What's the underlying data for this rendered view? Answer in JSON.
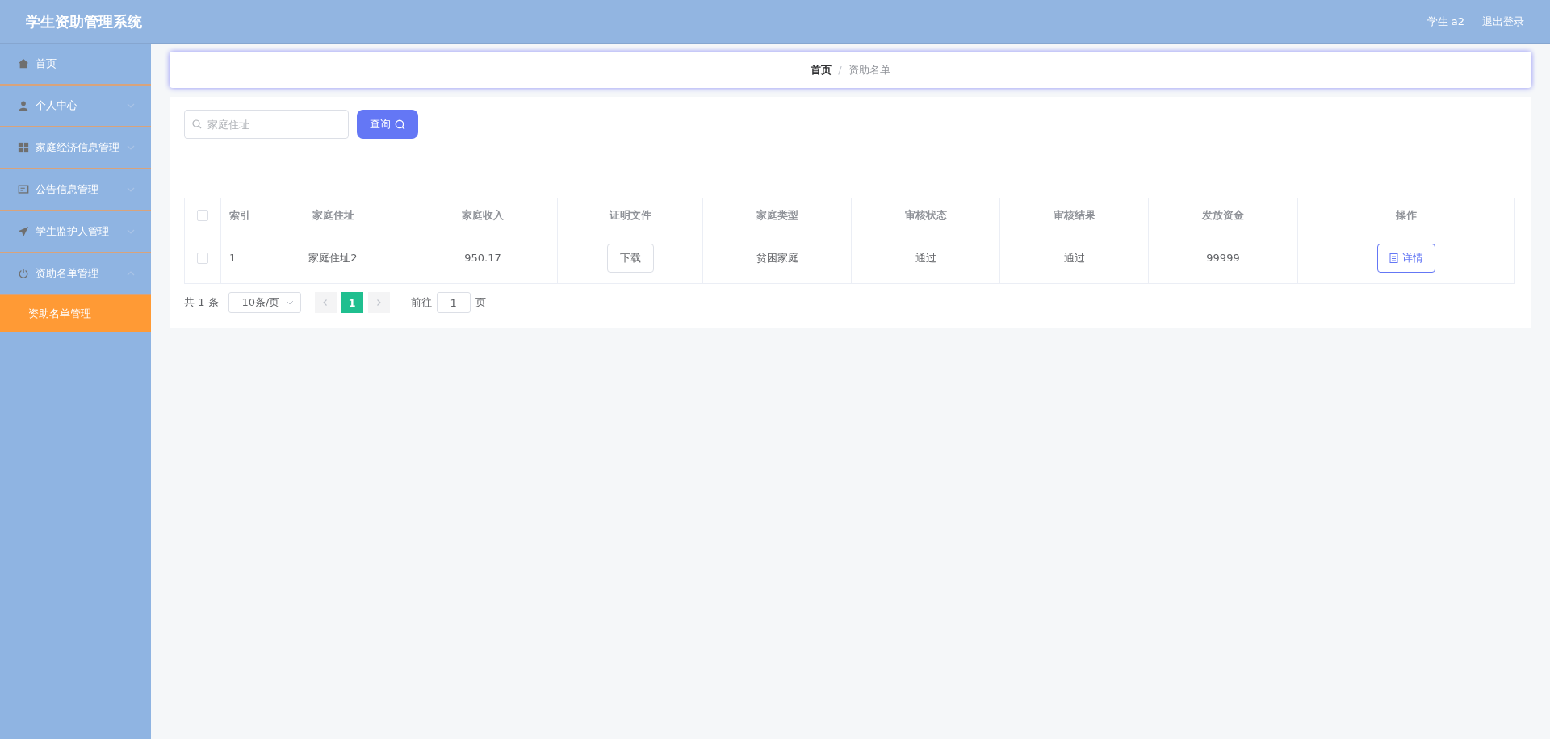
{
  "header": {
    "title": "学生资助管理系统",
    "user": "学生 a2",
    "logout": "退出登录"
  },
  "sidebar": {
    "items": [
      {
        "label": "首页",
        "kind": "home"
      },
      {
        "label": "个人中心",
        "kind": "user",
        "expanded": false
      },
      {
        "label": "家庭经济信息管理",
        "kind": "grid",
        "expanded": false
      },
      {
        "label": "公告信息管理",
        "kind": "monitor",
        "expanded": false
      },
      {
        "label": "学生监护人管理",
        "kind": "send",
        "expanded": false
      },
      {
        "label": "资助名单管理",
        "kind": "power",
        "expanded": true,
        "children": [
          {
            "label": "资助名单管理",
            "selected": true
          }
        ]
      }
    ]
  },
  "breadcrumb": {
    "items": [
      "首页",
      "资助名单"
    ],
    "separator": "/"
  },
  "search": {
    "placeholder": "家庭住址",
    "button": "查询"
  },
  "table": {
    "all_checked": false,
    "columns": [
      "索引",
      "家庭住址",
      "家庭收入",
      "证明文件",
      "家庭类型",
      "审核状态",
      "审核结果",
      "发放资金",
      "操作"
    ],
    "rows": [
      {
        "checked": false,
        "index": "1",
        "address": "家庭住址2",
        "income": "950.17",
        "file_button": "下载",
        "type": "贫困家庭",
        "status": "通过",
        "result": "通过",
        "funds": "99999",
        "action": "详情"
      }
    ]
  },
  "pagination": {
    "total": "共 1 条",
    "page_size": "10条/页",
    "pages": [
      {
        "label": "1",
        "selected": true
      }
    ],
    "goto_label": "前往",
    "goto_value": "1",
    "goto_suffix": "页"
  }
}
